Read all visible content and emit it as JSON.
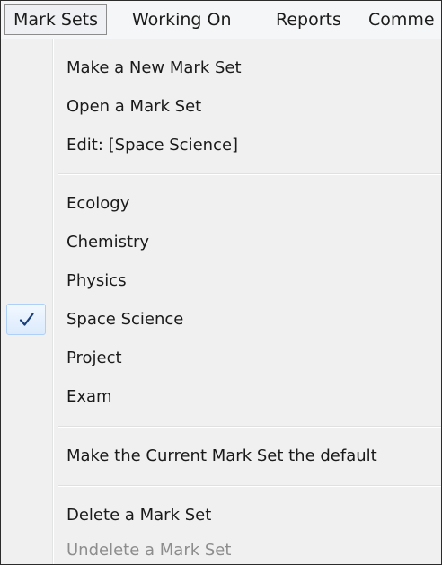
{
  "menubar": {
    "items": [
      {
        "label": "Mark Sets"
      },
      {
        "label": "Working On"
      },
      {
        "label": "Reports"
      },
      {
        "label": "Comme"
      }
    ]
  },
  "dropdown": {
    "group1": [
      {
        "label": "Make a New Mark Set"
      },
      {
        "label": "Open a Mark Set"
      },
      {
        "label": "Edit: [Space Science]"
      }
    ],
    "group2": [
      {
        "label": "Ecology"
      },
      {
        "label": "Chemistry"
      },
      {
        "label": "Physics"
      },
      {
        "label": "Space Science",
        "checked": true
      },
      {
        "label": "Project"
      },
      {
        "label": "Exam"
      }
    ],
    "group3": [
      {
        "label": "Make the Current Mark Set the default"
      }
    ],
    "group4": [
      {
        "label": "Delete a Mark Set"
      },
      {
        "label": "Undelete a Mark Set",
        "disabled": true
      }
    ],
    "check_icon": "checkmark-icon"
  }
}
